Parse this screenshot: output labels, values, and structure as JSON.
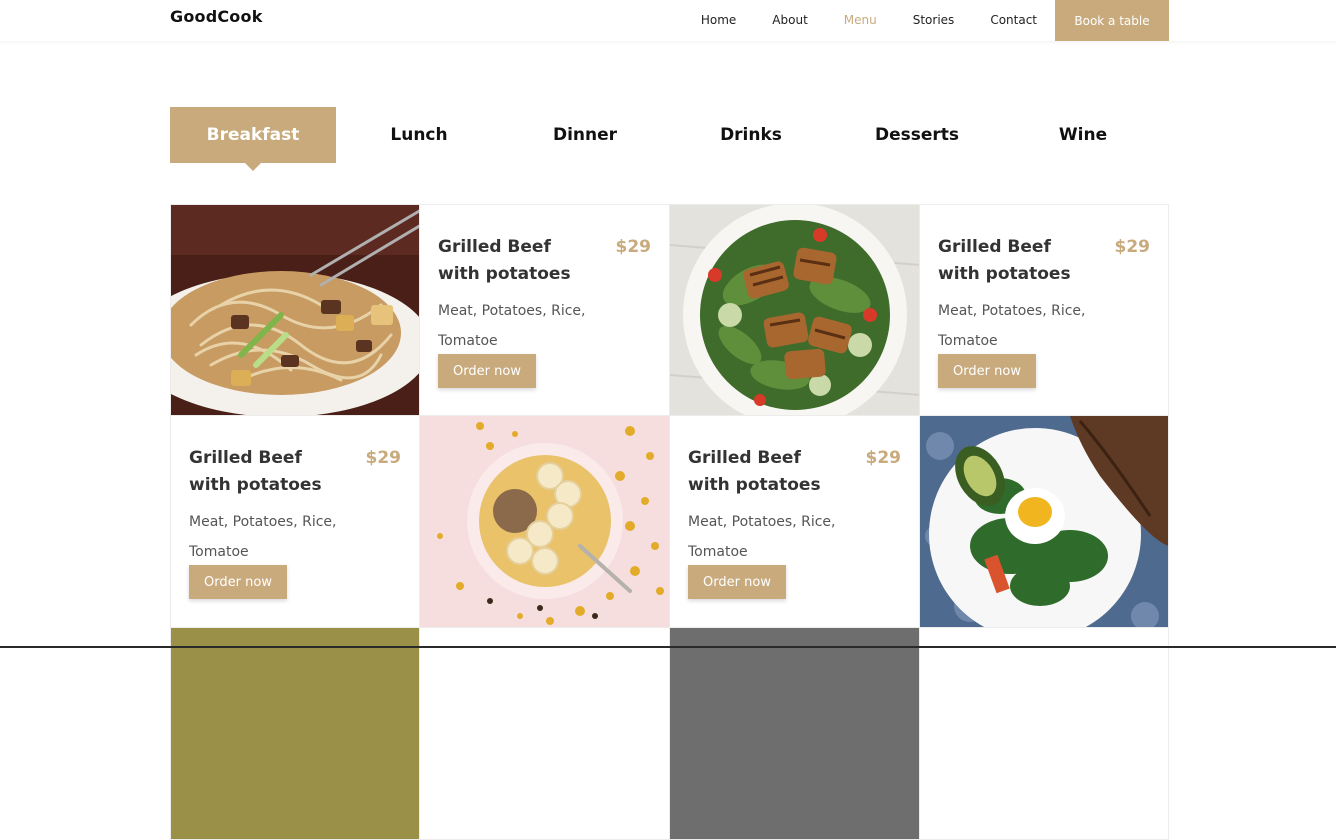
{
  "header": {
    "brand": "GoodCook",
    "nav": [
      {
        "label": "Home"
      },
      {
        "label": "About"
      },
      {
        "label": "Menu",
        "active": true
      },
      {
        "label": "Stories"
      },
      {
        "label": "Contact"
      }
    ],
    "cta_label": "Book a table"
  },
  "tabs": [
    {
      "label": "Breakfast",
      "active": true
    },
    {
      "label": "Lunch"
    },
    {
      "label": "Dinner"
    },
    {
      "label": "Drinks"
    },
    {
      "label": "Desserts"
    },
    {
      "label": "Wine"
    }
  ],
  "menu_items": [
    {
      "title": "Grilled Beef with potatoes",
      "price": "$29",
      "desc": "Meat, Potatoes, Rice, Tomatoe",
      "button": "Order now"
    },
    {
      "title": "Grilled Beef with potatoes",
      "price": "$29",
      "desc": "Meat, Potatoes, Rice, Tomatoe",
      "button": "Order now"
    },
    {
      "title": "Grilled Beef with potatoes",
      "price": "$29",
      "desc": "Meat, Potatoes, Rice, Tomatoe",
      "button": "Order now"
    },
    {
      "title": "Grilled Beef with potatoes",
      "price": "$29",
      "desc": "Meat, Potatoes, Rice, Tomatoe",
      "button": "Order now"
    }
  ],
  "photos": [
    {
      "subject": "noodle-stir-fry-photo"
    },
    {
      "subject": "grilled-halloumi-salad-photo"
    },
    {
      "subject": "banana-oatmeal-bowl-photo"
    },
    {
      "subject": "avocado-egg-salad-photo"
    }
  ],
  "colors": {
    "accent": "#c8aa7d",
    "text": "#333333",
    "muted": "#555555"
  }
}
